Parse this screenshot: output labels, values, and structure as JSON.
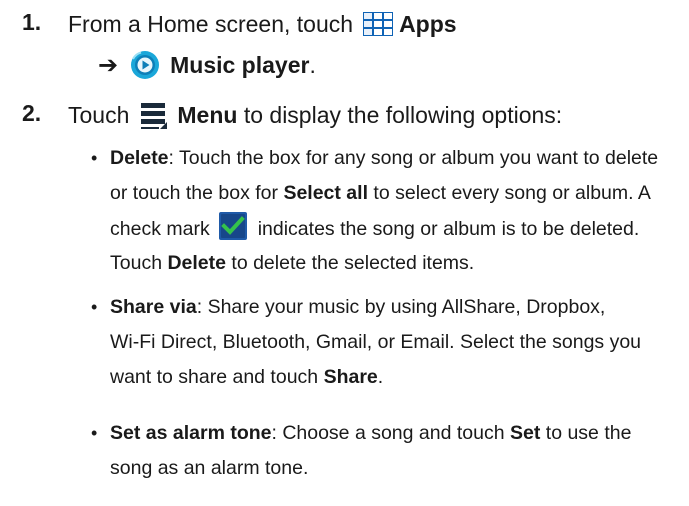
{
  "steps": [
    {
      "number": "1.",
      "line1": {
        "prefix": "From a Home screen, touch",
        "apps_label": "Apps"
      },
      "line2": {
        "arrow": "➔",
        "music_label": "Music player",
        "suffix": "."
      }
    },
    {
      "number": "2.",
      "prefix": "Touch",
      "menu_label": "Menu",
      "suffix": " to display the following options:"
    }
  ],
  "bullets": {
    "delete": {
      "term": "Delete",
      "l1": ": Touch the box for any song or album you want to delete",
      "l2_pre": "or touch the box for ",
      "l2_bold": "Select all",
      "l2_post": " to select every song or album. A",
      "l3_pre": "check mark",
      "l3_post": "indicates the song or album is to be deleted.",
      "l4_pre": "Touch ",
      "l4_bold": "Delete",
      "l4_post": " to delete the selected items."
    },
    "share": {
      "term": "Share via",
      "l1": ": Share your music by using AllShare, Dropbox,",
      "l2": "Wi-Fi Direct, Bluetooth, Gmail, or Email. Select the songs you",
      "l3_pre": "want to share and touch ",
      "l3_bold": "Share",
      "l3_post": "."
    },
    "alarm": {
      "term": "Set as alarm tone",
      "l1_pre": ": Choose a song and touch ",
      "l1_bold": "Set",
      "l1_post": " to use the",
      "l2": "song as an alarm tone."
    }
  },
  "bullet_char": "•",
  "colors": {
    "apps_icon": "#0f63b5",
    "music_icon_outer": "#1aa7d9",
    "music_icon_inner": "#0d7fb8",
    "menu_icon": "#1a2a3a",
    "check_box": "#1f5aa8",
    "check_mark": "#35c24b"
  }
}
